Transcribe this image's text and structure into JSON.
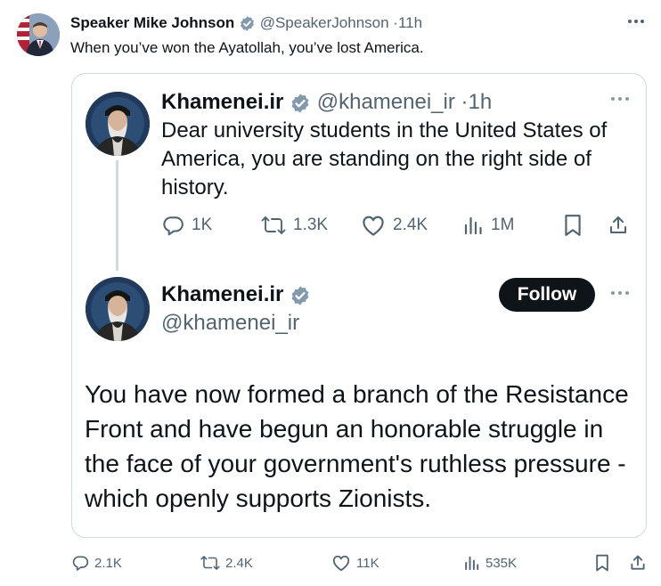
{
  "outer": {
    "author_name": "Speaker Mike Johnson",
    "handle": "@SpeakerJohnson",
    "separator": "·",
    "time": "11h",
    "text": "When you’ve won the Ayatollah, you’ve lost America.",
    "actions": {
      "replies": "2.1K",
      "reposts": "2.4K",
      "likes": "11K",
      "views": "535K"
    }
  },
  "quoted_first": {
    "author_name": "Khamenei.ir",
    "handle": "@khamenei_ir",
    "separator": "·",
    "time": "1h",
    "text": "Dear university students in the United States of America, you are standing on the right side of history.",
    "actions": {
      "replies": "1K",
      "reposts": "1.3K",
      "likes": "2.4K",
      "views": "1M"
    }
  },
  "quoted_second": {
    "author_name": "Khamenei.ir",
    "handle": "@khamenei_ir",
    "follow_label": "Follow",
    "text": "You have now formed a branch of the Resistance Front and have begun an honorable struggle in the face of your government's ruthless pressure - which openly supports Zionists."
  },
  "icons": {
    "verified": "verified-badge-icon",
    "more": "more-dots-icon",
    "reply": "reply-icon",
    "repost": "repost-icon",
    "like": "heart-icon",
    "views": "views-icon",
    "bookmark": "bookmark-icon",
    "share": "share-icon"
  },
  "colors": {
    "text": "#0f1419",
    "muted": "#536471",
    "border": "#cfd9de",
    "verified_badge": "#829aab",
    "follow_bg": "#0f1419"
  }
}
